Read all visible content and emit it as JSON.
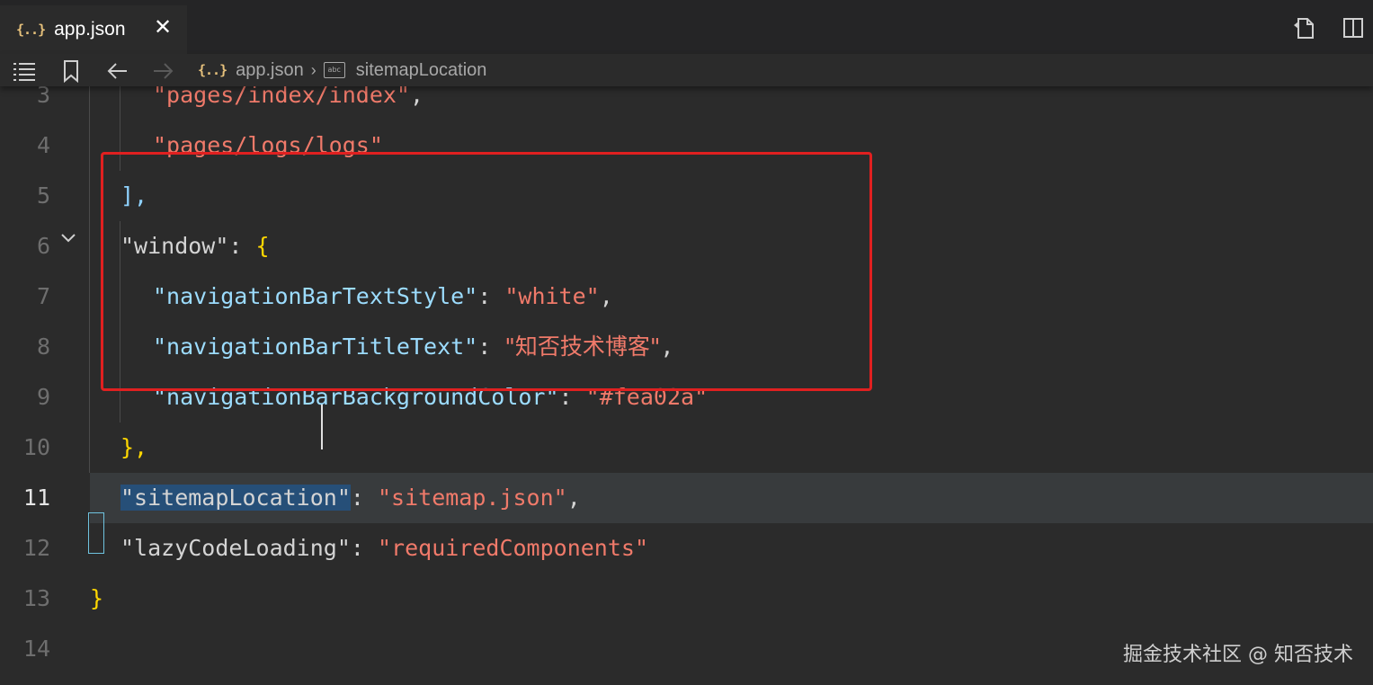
{
  "tab": {
    "icon": "{..}",
    "label": "app.json",
    "close": "✕"
  },
  "breadcrumb": {
    "icon": "{..}",
    "file": "app.json",
    "separator": "›",
    "symbol_icon": "abc",
    "symbol": "sitemapLocation"
  },
  "lines": [
    {
      "num": "3",
      "tokens": [
        {
          "c": "s",
          "t": "\"pages/index/index\""
        },
        {
          "c": "p",
          "t": ","
        }
      ]
    },
    {
      "num": "4",
      "tokens": [
        {
          "c": "s",
          "t": "\"pages/logs/logs\""
        }
      ]
    },
    {
      "num": "5",
      "tokens": [
        {
          "c": "p",
          "t": "],"
        }
      ]
    },
    {
      "num": "6",
      "tokens": [
        {
          "c": "p",
          "t": "\"window\": "
        },
        {
          "c": "p",
          "t": "{"
        }
      ]
    },
    {
      "num": "7",
      "tokens": [
        {
          "c": "k",
          "t": "\"navigationBarTextStyle\""
        },
        {
          "c": "p",
          "t": ": "
        },
        {
          "c": "s",
          "t": "\"white\""
        },
        {
          "c": "p",
          "t": ","
        }
      ]
    },
    {
      "num": "8",
      "tokens": [
        {
          "c": "k",
          "t": "\"navigationBarTitleText\""
        },
        {
          "c": "p",
          "t": ": "
        },
        {
          "c": "s",
          "t": "\"知否技术博客\""
        },
        {
          "c": "p",
          "t": ","
        }
      ]
    },
    {
      "num": "9",
      "tokens": [
        {
          "c": "k",
          "t": "\"navigationBarBackgroundColor\""
        },
        {
          "c": "p",
          "t": ": "
        },
        {
          "c": "s",
          "t": "\"#fea02a\""
        }
      ]
    },
    {
      "num": "10",
      "tokens": [
        {
          "c": "p",
          "t": "},"
        }
      ]
    },
    {
      "num": "11",
      "tokens": [
        {
          "c": "p",
          "t": "\"sitemapLocation\""
        },
        {
          "c": "p",
          "t": ": "
        },
        {
          "c": "s",
          "t": "\"sitemap.json\""
        },
        {
          "c": "p",
          "t": ","
        }
      ]
    },
    {
      "num": "12",
      "tokens": [
        {
          "c": "p",
          "t": "\"lazyCodeLoading\""
        },
        {
          "c": "p",
          "t": ": "
        },
        {
          "c": "s",
          "t": "\"requiredComponents\""
        }
      ]
    },
    {
      "num": "13",
      "tokens": [
        {
          "c": "p",
          "t": "}"
        }
      ]
    },
    {
      "num": "14",
      "tokens": []
    }
  ],
  "current_line": "11",
  "highlight_token": "\"sitemapLocation\"",
  "boxed_lines": [
    "6",
    "7",
    "8",
    "9",
    "10"
  ],
  "watermark": "掘金技术社区 @ 知否技术",
  "colors": {
    "string": "#f07a6a",
    "key": "#9cdcfe",
    "punct": "#d4d4d4",
    "box": "#e02020",
    "current_line_bg": "#383b3d"
  }
}
